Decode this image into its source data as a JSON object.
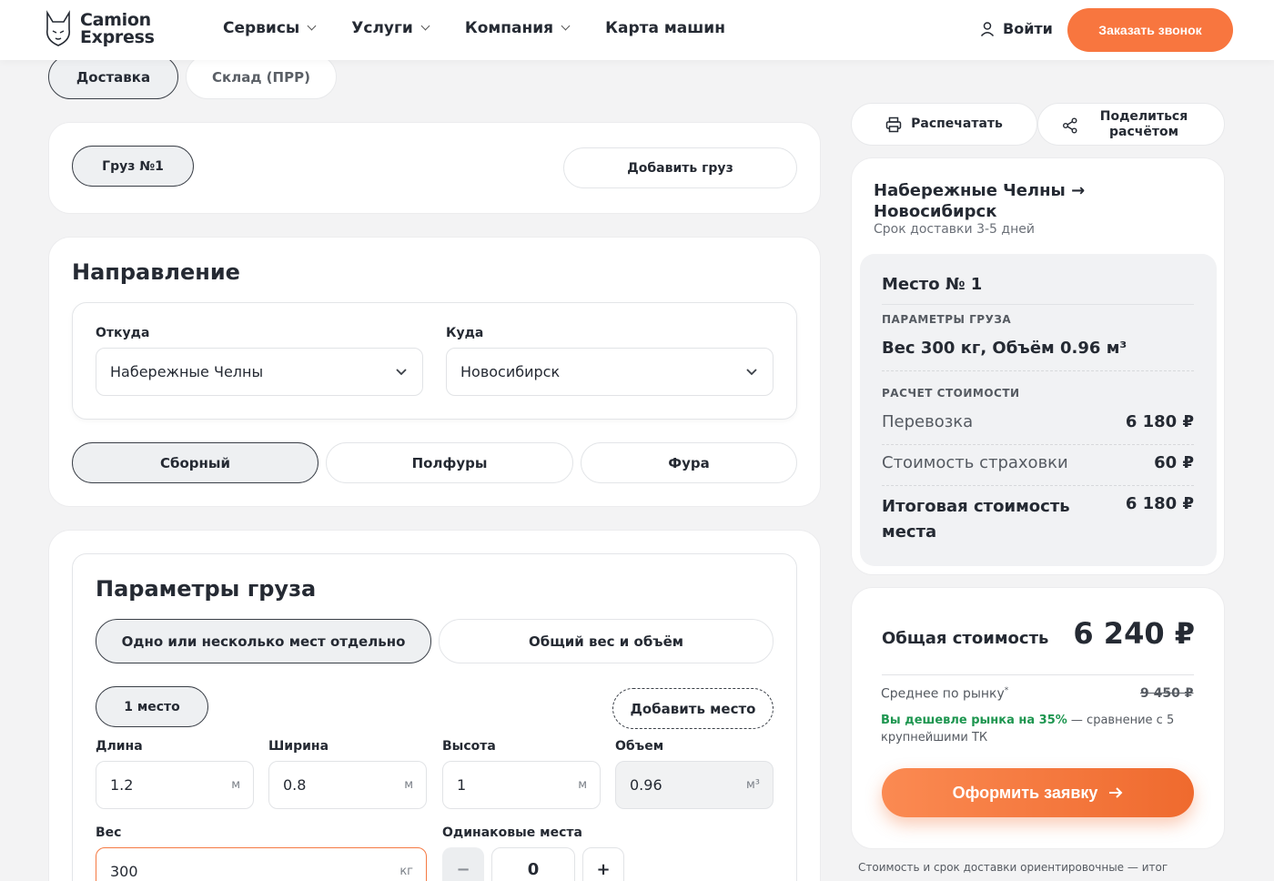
{
  "header": {
    "logo_line1": "Camion",
    "logo_line2": "Express",
    "nav": [
      "Сервисы",
      "Услуги",
      "Компания",
      "Карта машин"
    ],
    "login": "Войти",
    "callback": "Заказать звонок"
  },
  "top_tabs": {
    "active": "Доставка",
    "inactive": "Склад (ПРР)"
  },
  "cargo": {
    "tab": "Груз №1",
    "add": "Добавить груз"
  },
  "direction": {
    "title": "Направление",
    "from_label": "Откуда",
    "from_value": "Набережные Челны",
    "to_label": "Куда",
    "to_value": "Новосибирск",
    "types": [
      "Сборный",
      "Полфуры",
      "Фура"
    ]
  },
  "params": {
    "title": "Параметры груза",
    "mode_active": "Одно или несколько мест отдельно",
    "mode_inactive": "Общий вес и объём",
    "place_tab": "1 место",
    "add_place": "Добавить место",
    "length_label": "Длина",
    "length": "1.2",
    "length_unit": "м",
    "width_label": "Ширина",
    "width": "0.8",
    "width_unit": "м",
    "height_label": "Высота",
    "height": "1",
    "height_unit": "м",
    "volume_label": "Объем",
    "volume": "0.96",
    "volume_unit": "м³",
    "weight_label": "Вес",
    "weight": "300",
    "weight_unit": "кг",
    "same_label": "Одинаковые места",
    "minus": "−",
    "same_value": "0",
    "plus": "+"
  },
  "actions": {
    "print": "Распечатать",
    "share_line1": "Поделиться",
    "share_line2": "расчётом"
  },
  "summary": {
    "route_line1": "Набережные Челны →",
    "route_line2": "Новосибирск",
    "term": "Срок доставки 3-5 дней",
    "place_title": "Место № 1",
    "params_caption": "ПАРАМЕТРЫ ГРУЗА",
    "params_value": "Вес 300 кг, Объём 0.96 м³",
    "calc_caption": "РАСЧЕТ СТОИМОСТИ",
    "transport_label": "Перевозка",
    "transport_value": "6 180 ₽",
    "insurance_label": "Стоимость страховки",
    "insurance_value": "60 ₽",
    "place_total_line1": "Итоговая стоимость",
    "place_total_line2": "места",
    "place_total_value": "6 180 ₽"
  },
  "total": {
    "label": "Общая стоимость",
    "value": "6 240 ₽",
    "market_label": "Среднее по рынку",
    "market_mark": "*",
    "market_value": "9 450 ₽",
    "cheaper": "Вы дешевле рынка на 35%",
    "cheaper_rest": " — сравнение с 5 крупнейшими ТК",
    "order": "Оформить заявку",
    "footnote": "Стоимость и срок доставки ориентировочные — итог"
  }
}
